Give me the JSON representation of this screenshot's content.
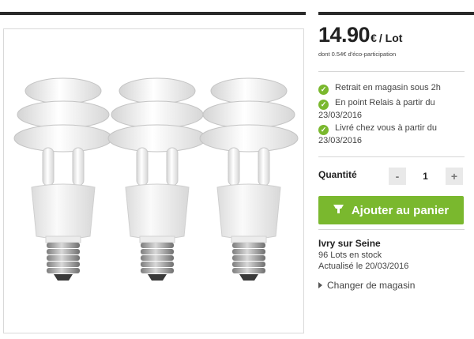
{
  "price": {
    "amount": "14.90",
    "currency": "€",
    "unit": "/ Lot",
    "eco_participation": "dont 0.54€ d'éco-participation"
  },
  "availability": [
    {
      "text": "Retrait en magasin sous 2h"
    },
    {
      "text": "En point Relais à partir du 23/03/2016"
    },
    {
      "text": "Livré chez vous à partir du 23/03/2016"
    }
  ],
  "quantity": {
    "label": "Quantité",
    "value": "1",
    "minus": "-",
    "plus": "+"
  },
  "cart": {
    "label": "Ajouter au panier"
  },
  "store": {
    "name": "Ivry sur Seine",
    "stock": "96 Lots en stock",
    "updated": "Actualisé le 20/03/2016",
    "change": "Changer de magasin"
  },
  "product_image": {
    "bulb_count": 3,
    "icon": "spiral-bulb"
  },
  "colors": {
    "accent_green": "#7ab82e",
    "text_dark": "#222222",
    "divider": "#d6d6d6"
  }
}
